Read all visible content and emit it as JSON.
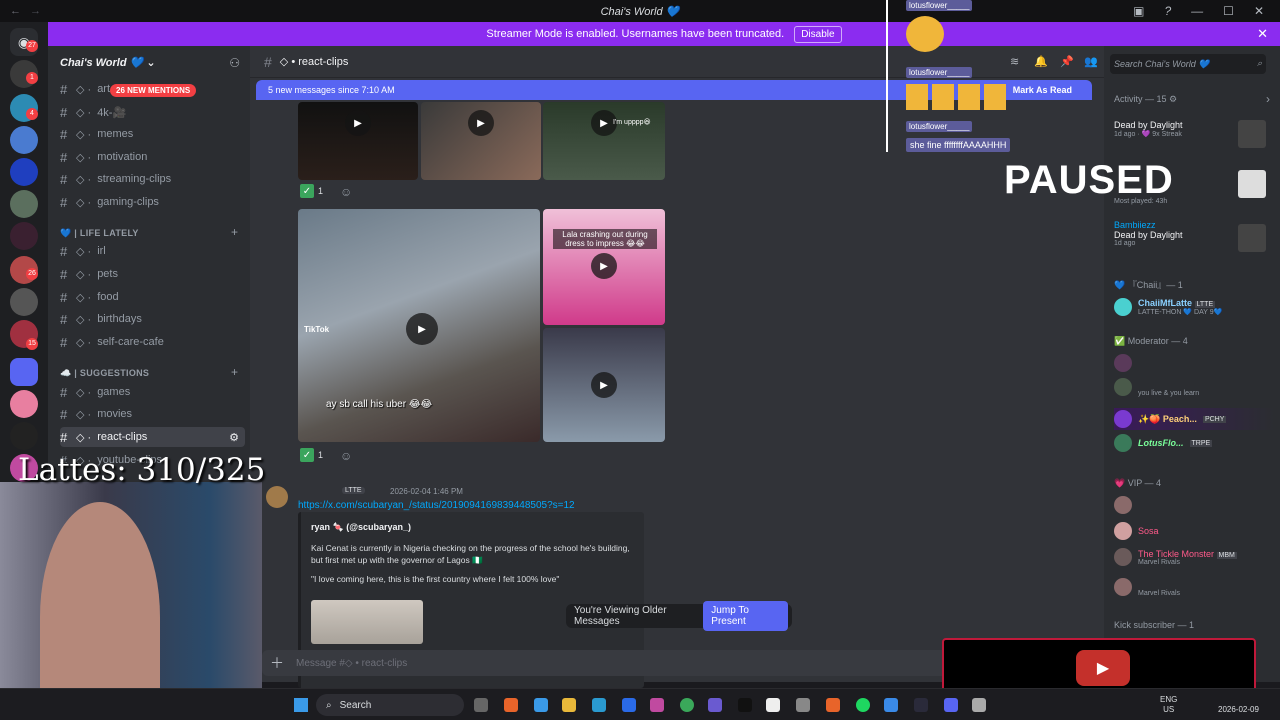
{
  "title_bar": {
    "title": "Chai's World 💙"
  },
  "banner": {
    "text": "Streamer Mode is enabled. Usernames have been truncated.",
    "button": "Disable"
  },
  "guild_badges": [
    "27",
    "1",
    "4",
    "26",
    "15"
  ],
  "sidebar": {
    "server_name": "Chai's World 💙",
    "mentions_pill": "26 NEW MENTIONS",
    "channels_top": [
      "art",
      "4k-🎥",
      "memes",
      "motivation",
      "streaming-clips",
      "gaming-clips"
    ],
    "cat_life": "💙 | LIFE LATELY",
    "channels_life": [
      "irl",
      "pets",
      "food",
      "birthdays",
      "self-care-cafe"
    ],
    "cat_suggestions": "☁️ | SUGGESTIONS",
    "channels_sugg": [
      "games",
      "movies",
      "react-clips",
      "youtube-clips"
    ]
  },
  "header": {
    "channel": "◇ • react-clips",
    "search_placeholder": "Search Chai's World 💙"
  },
  "new_messages": {
    "text": "5 new messages since 7:10 AM",
    "mark": "Mark As Read"
  },
  "reactions": {
    "count1": "1",
    "count2": "1"
  },
  "videos": {
    "caption_main": "ay sb call his uber 😂😂",
    "caption_pink": "Lala crashing out during dress to impress 😂😂",
    "caption_top": "I'm upppp😆",
    "tiktok": "TikTok"
  },
  "message": {
    "badge": "LTTE",
    "timestamp": "2026-02-04 1:46 PM",
    "link": "https://x.com/scubaryan_/status/2019094169839448505?s=12",
    "embed_author": "ryan 🍬 (@scubaryan_)",
    "embed_text": "Kai Cenat is currently in Nigeria checking on the progress of the school he's building, but first met up with the governor of Lagos 🇳🇬",
    "embed_quote": "\"I love coming here, this is the first country where I felt 100% love\""
  },
  "older": {
    "text": "You're Viewing Older Messages",
    "jump": "Jump To Present"
  },
  "composer": {
    "placeholder": "Message #◇ • react-clips"
  },
  "members": {
    "activity": "Activity — 15 ⚙",
    "act1_game": "Dead by Daylight",
    "act1_meta": "1d ago · 💜 9x Streak",
    "act2_meta": "Most played: 43h",
    "act3_name": "Bambiiezz",
    "act3_game": "Dead by Daylight",
    "act3_meta": "1d ago",
    "chaii_head": "💙 『Chaii』— 1",
    "chaii_name": "ChaiiMfLatte",
    "chaii_tag": "LTTE",
    "chaii_status": "LATTE-THON 💙 DAY 9💙",
    "mod_head": "✅ Moderator — 4",
    "mod2_status": "you live & you learn",
    "mod3_name": "✨🍑 Peach...",
    "mod3_tag": "PCHY",
    "mod4_name": "LotusFlo...",
    "mod4_tag": "TRPE",
    "vip_head": "💗 VIP — 4",
    "vip2_name": "Sosa",
    "vip3_name": "The Tickle Monster",
    "vip3_tag": "MBM",
    "vip3_status": "Marvel Rivals",
    "vip4_status": "Marvel Rivals",
    "kick_head": "Kick subscriber — 1"
  },
  "overlay": {
    "paused": "PAUSED",
    "lattes": "Lattes: 310/325",
    "chat_user": "lotusflower_____",
    "chat_msg": "she fine ffffffffAAAAHHH"
  },
  "taskbar": {
    "search": "Search",
    "lang": "ENG\nUS",
    "date": "2026-02-09"
  }
}
